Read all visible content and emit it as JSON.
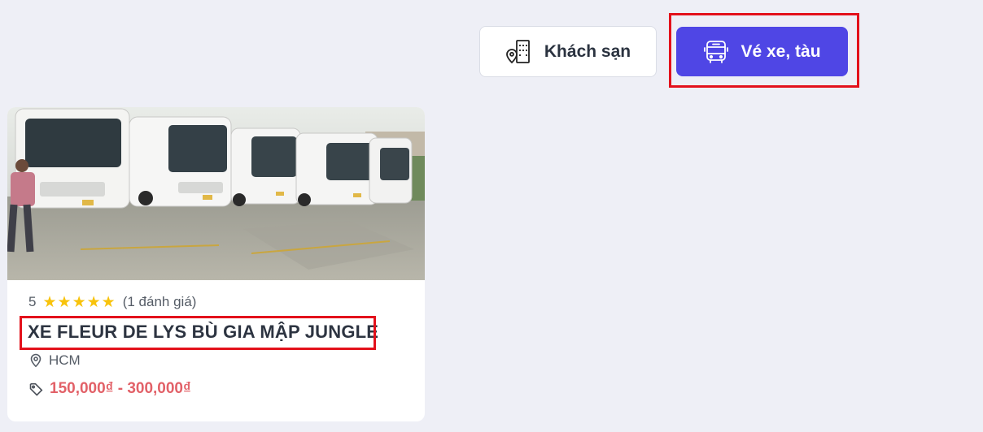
{
  "tabs": {
    "hotel_label": "Khách sạn",
    "bus_label": "Vé xe, tàu"
  },
  "card": {
    "rating_value": "5",
    "stars": 5,
    "review_count": "(1 đánh giá)",
    "title": "XE FLEUR DE LYS BÙ GIA MẬP JUNGLE",
    "location": "HCM",
    "price_range": "150,000₫ - 300,000₫"
  },
  "icons": {
    "hotel": "hotel-location-icon",
    "bus": "bus-icon",
    "star": "star-icon",
    "location": "map-pin-icon",
    "price": "tag-icon"
  },
  "colors": {
    "accent": "#4f46e5",
    "price": "#e26168",
    "star": "#f8c30c",
    "highlight": "#e3111b"
  }
}
